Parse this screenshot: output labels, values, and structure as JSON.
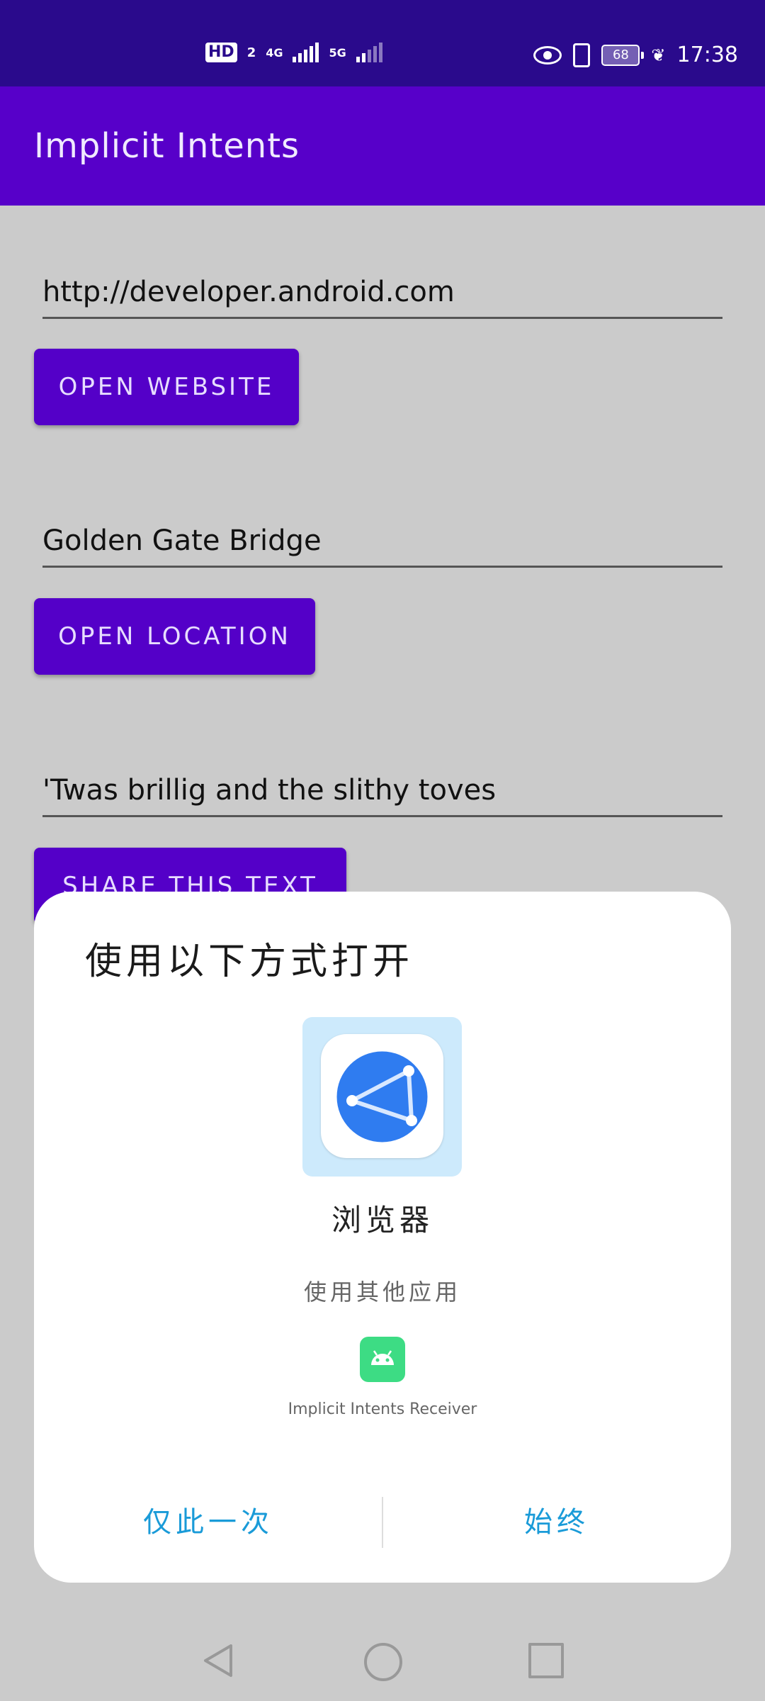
{
  "status_bar": {
    "hd_label": "HD",
    "hd_sim": "2",
    "net1": "4G",
    "net2": "5G",
    "battery": "68",
    "time": "17:38"
  },
  "app_bar": {
    "title": "Implicit Intents"
  },
  "form": {
    "website_field_value": "http://developer.android.com",
    "website_button": "Open Website",
    "location_field_value": "Golden Gate Bridge",
    "location_button": "Open Location",
    "share_field_value": "'Twas brillig and the slithy toves",
    "share_button": "Share This Text"
  },
  "dialog": {
    "title": "使用以下方式打开",
    "app_name": "浏览器",
    "other_apps_label": "使用其他应用",
    "other_app_name": "Implicit Intents Receiver",
    "just_once": "仅此一次",
    "always": "始终"
  },
  "colors": {
    "status_bar": "#2a0a8c",
    "app_bar": "#5700c9",
    "button": "#5400c8",
    "dialog_action": "#1a9bd8",
    "scrim_bg": "#cbcbcb"
  },
  "icons": [
    "eye-icon",
    "vibrate-icon",
    "battery-icon",
    "leaf-icon",
    "browser-globe-icon",
    "android-app-icon",
    "nav-back-icon",
    "nav-home-icon",
    "nav-recents-icon"
  ]
}
